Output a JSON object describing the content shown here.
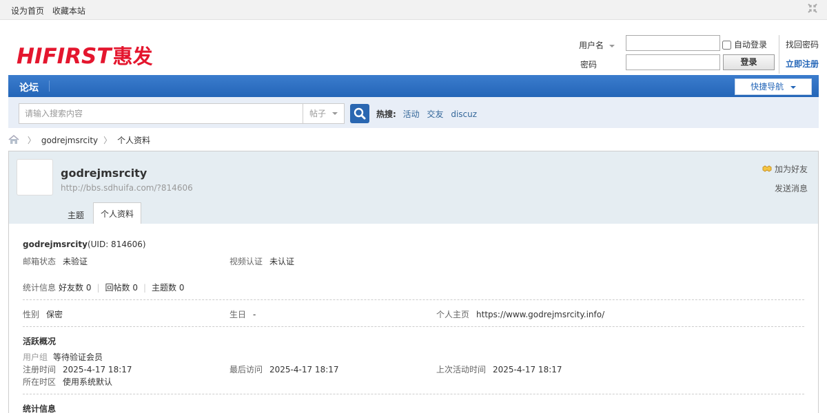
{
  "topbar": {
    "set_home": "设为首页",
    "bookmark": "收藏本站"
  },
  "logo": {
    "en": "HIFIRST",
    "cn": "惠发"
  },
  "login": {
    "username_label": "用户名",
    "password_label": "密码",
    "auto_login": "自动登录",
    "login_button": "登录",
    "forgot_password": "找回密码",
    "register": "立即注册"
  },
  "nav": {
    "forum": "论坛",
    "quick_nav": "快捷导航"
  },
  "search": {
    "placeholder": "请输入搜索内容",
    "type": "帖子",
    "hot_label": "热搜:",
    "hot_terms": [
      "活动",
      "交友",
      "discuz"
    ]
  },
  "breadcrumb": {
    "user": "godrejmsrcity",
    "current": "个人资料"
  },
  "profile": {
    "username": "godrejmsrcity",
    "url": "http://bbs.sdhuifa.com/?814606",
    "add_friend": "加为好友",
    "send_message": "发送消息",
    "tabs": [
      "主题",
      "个人资料"
    ],
    "uid_text": "(UID: 814606)",
    "email_status_label": "邮箱状态",
    "email_status": "未验证",
    "video_auth_label": "视频认证",
    "video_auth": "未认证",
    "stats_label": "统计信息",
    "friends": "好友数 0",
    "replies": "回帖数 0",
    "threads": "主题数 0",
    "gender_label": "性别",
    "gender": "保密",
    "birthday_label": "生日",
    "birthday": "-",
    "homepage_label": "个人主页",
    "homepage": "https://www.godrejmsrcity.info/",
    "activity_title": "活跃概况",
    "group_label": "用户组",
    "group": "等待验证会员",
    "reg_time_label": "注册时间",
    "reg_time": "2025-4-17 18:17",
    "last_visit_label": "最后访问",
    "last_visit": "2025-4-17 18:17",
    "last_active_label": "上次活动时间",
    "last_active": "2025-4-17 18:17",
    "timezone_label": "所在时区",
    "timezone": "使用系统默认",
    "stats_title": "统计信息"
  },
  "colors": {
    "nav_blue": "#2466b8",
    "logo_red": "#e4162e",
    "link_blue": "#336699"
  }
}
